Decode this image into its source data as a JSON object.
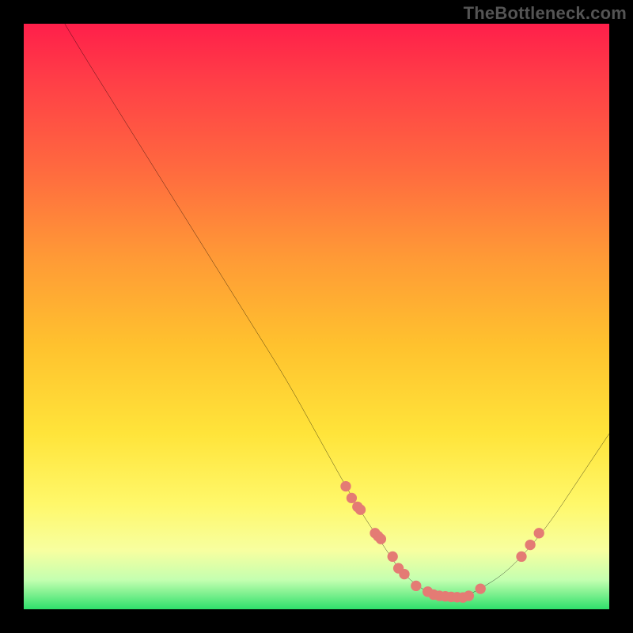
{
  "watermark": "TheBottleneck.com",
  "chart_data": {
    "type": "line",
    "title": "",
    "xlabel": "",
    "ylabel": "",
    "xlim": [
      0,
      100
    ],
    "ylim": [
      0,
      100
    ],
    "grid": false,
    "legend": false,
    "series": [
      {
        "name": "bottleneck-curve",
        "type": "line",
        "color": "#000000",
        "x": [
          7,
          10,
          15,
          20,
          25,
          30,
          35,
          40,
          45,
          50,
          55,
          58,
          60,
          62,
          64,
          66,
          68,
          70,
          72,
          75,
          78,
          82,
          86,
          90,
          94,
          98,
          100
        ],
        "y": [
          100,
          95,
          87,
          79,
          71,
          63,
          55,
          47,
          39,
          30,
          21,
          16,
          13,
          10,
          7,
          5,
          3.5,
          2.5,
          2,
          2,
          3.5,
          6,
          10,
          15,
          21,
          27,
          30
        ]
      },
      {
        "name": "highlight-points",
        "type": "scatter",
        "color": "#e47b74",
        "x": [
          55,
          56,
          57,
          57.5,
          60,
          60.5,
          61,
          63,
          64,
          65,
          67,
          69,
          70,
          71,
          72,
          73,
          74,
          75,
          76,
          78,
          85,
          86.5,
          88
        ],
        "y": [
          21,
          19,
          17.5,
          17,
          13,
          12.5,
          12,
          9,
          7,
          6,
          4,
          3,
          2.5,
          2.3,
          2.2,
          2.1,
          2.05,
          2,
          2.3,
          3.5,
          9,
          11,
          13
        ]
      }
    ],
    "background_gradient": {
      "axis": "y",
      "stops": [
        {
          "pos": 0.0,
          "color": "#ff1f4a"
        },
        {
          "pos": 0.1,
          "color": "#ff3f47"
        },
        {
          "pos": 0.25,
          "color": "#ff6a3f"
        },
        {
          "pos": 0.4,
          "color": "#ff9a36"
        },
        {
          "pos": 0.55,
          "color": "#ffc22e"
        },
        {
          "pos": 0.7,
          "color": "#ffe43a"
        },
        {
          "pos": 0.82,
          "color": "#fff86a"
        },
        {
          "pos": 0.9,
          "color": "#f7ffa0"
        },
        {
          "pos": 0.95,
          "color": "#c4ffb0"
        },
        {
          "pos": 1.0,
          "color": "#2fe06b"
        }
      ]
    }
  }
}
